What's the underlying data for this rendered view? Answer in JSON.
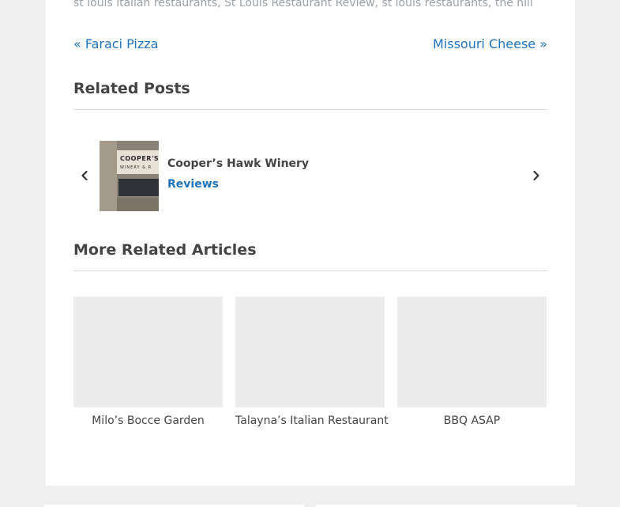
{
  "tags": {
    "items": [
      "st louis italian restaurants",
      "St Louis Restaurant Review",
      "st louis restaurants",
      "the hill"
    ],
    "separator": ","
  },
  "post_nav": {
    "prev_label": "« Faraci Pizza",
    "next_label": "Missouri Cheese »"
  },
  "related_posts": {
    "title": "Related Posts",
    "prev_icon": "chevron-left-icon",
    "next_icon": "chevron-right-icon",
    "items": [
      {
        "title": "Cooper’s Hawk Winery",
        "category": "Reviews",
        "thumb_sign_line1": "COOPER'S",
        "thumb_sign_line2": "WINERY & R"
      }
    ]
  },
  "more_related": {
    "title": "More Related Articles",
    "items": [
      {
        "caption": "Milo’s Bocce Garden"
      },
      {
        "caption": "Talayna’s Italian Restaurant"
      },
      {
        "caption": "BBQ ASAP"
      }
    ]
  },
  "colors": {
    "link": "#1e73be",
    "heading": "#444444",
    "muted": "#9aa0a6",
    "page_bg": "#f0f0f0",
    "placeholder": "#ececec"
  }
}
